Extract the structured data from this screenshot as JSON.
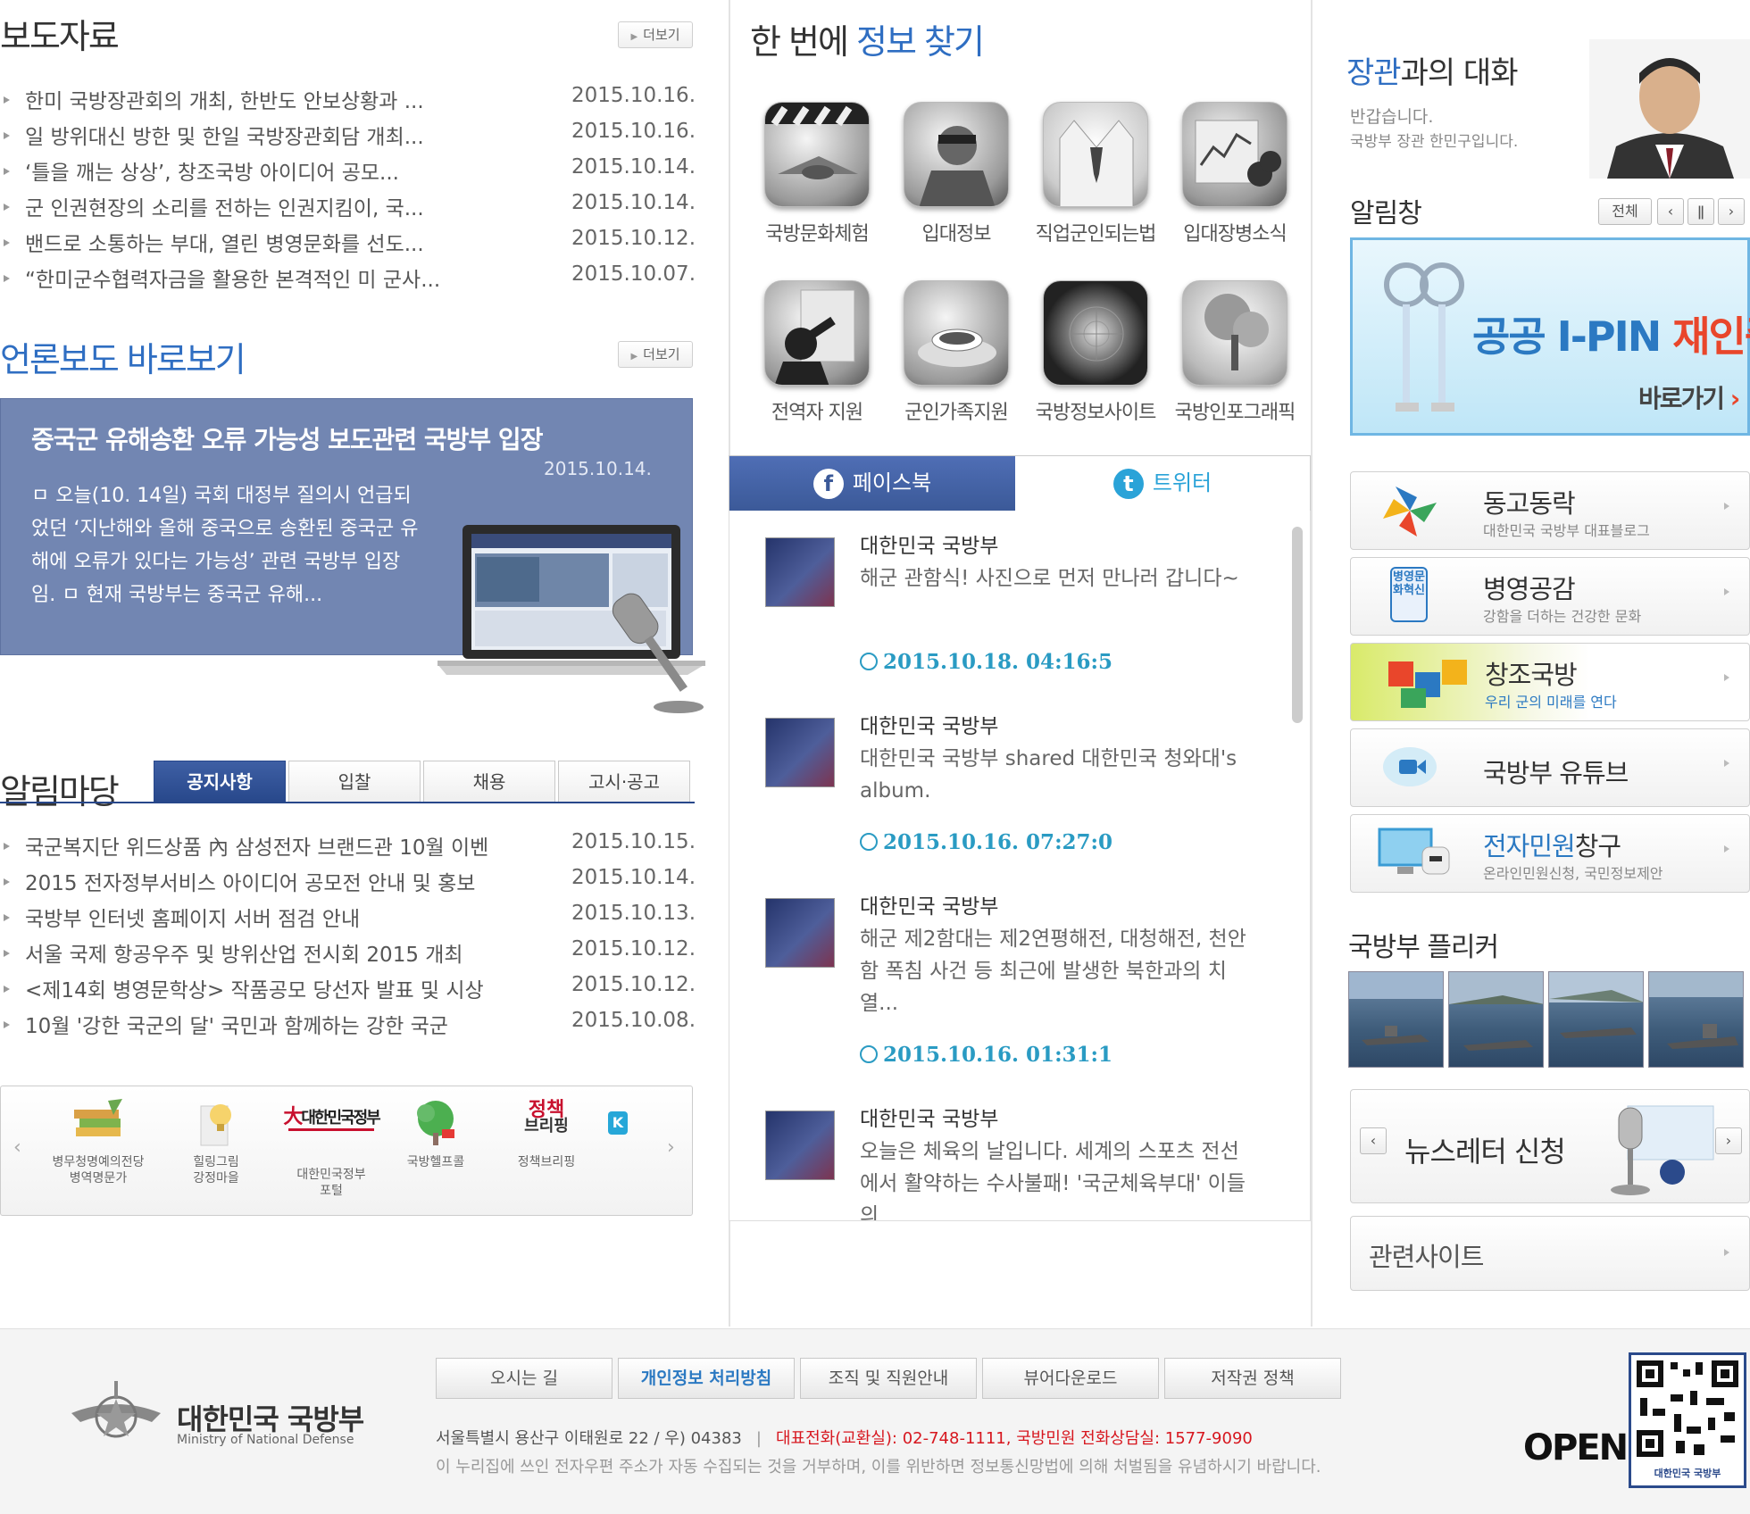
{
  "press": {
    "title": "보도자료",
    "more": "더보기",
    "items": [
      {
        "title": "한미 국방장관회의 개최, 한반도 안보상황과 ...",
        "date": "2015.10.16."
      },
      {
        "title": "일 방위대신 방한 및 한일 국방장관회담 개최...",
        "date": "2015.10.16."
      },
      {
        "title": "‘틀을 깨는 상상’, 창조국방 아이디어 공모...",
        "date": "2015.10.14."
      },
      {
        "title": "군 인권현장의 소리를 전하는 인권지킴이, 국...",
        "date": "2015.10.14."
      },
      {
        "title": "밴드로 소통하는 부대, 열린 병영문화를 선도...",
        "date": "2015.10.12."
      },
      {
        "title": "“한미군수협력자금을 활용한 본격적인 미 군사...",
        "date": "2015.10.07."
      }
    ]
  },
  "media": {
    "title": "언론보도 바로보기",
    "more": "더보기",
    "headline": "중국군 유해송환 오류 가능성 보도관련 국방부 입장",
    "date": "2015.10.14.",
    "body": "ㅁ 오늘(10. 14일) 국회 대정부 질의시 언급되었던 ‘지난해와 올해 중국으로 송환된 중국군 유해에 오류가 있다는 가능성’ 관련 국방부 입장임. ㅁ 현재 국방부는 중국군 유해..."
  },
  "notice": {
    "title": "알림마당",
    "tabs": [
      "공지사항",
      "입찰",
      "채용",
      "고시·공고"
    ],
    "items": [
      {
        "title": "국군복지단 위드상품 內 삼성전자 브랜드관 10월 이벤",
        "date": "2015.10.15."
      },
      {
        "title": "2015 전자정부서비스 아이디어 공모전 안내 및 홍보",
        "date": "2015.10.14."
      },
      {
        "title": "국방부 인터넷 홈페이지 서버 점검 안내",
        "date": "2015.10.13."
      },
      {
        "title": "서울 국제 항공우주 및 방위산업 전시회 2015 개최",
        "date": "2015.10.12."
      },
      {
        "title": "<제14회 병영문학상> 작품공모 당선자 발표 및 시상",
        "date": "2015.10.12."
      },
      {
        "title": "10월 '강한 국군의 달' 국민과 함께하는 강한 국군",
        "date": "2015.10.08."
      }
    ]
  },
  "banners": [
    {
      "l1": "병무청명예의전당",
      "l2": "병역명문가"
    },
    {
      "l1": "힐링그림",
      "l2": "강정마을"
    },
    {
      "l1": "대한민국정부",
      "l2": "포털"
    },
    {
      "l1": "국방헬프콜",
      "l2": ""
    },
    {
      "l1": "정책브리핑",
      "l2": ""
    }
  ],
  "banner_logo_texts": {
    "gov": "대한민국정부",
    "policy1": "정책",
    "policy2": "브리핑"
  },
  "find": {
    "title_prefix": "한 번에 ",
    "title_accent": "정보 찾기",
    "items": [
      "국방문화체험",
      "입대정보",
      "직업군인되는법",
      "입대장병소식",
      "전역자 지원",
      "군인가족지원",
      "국방정보사이트",
      "국방인포그래픽"
    ]
  },
  "sns": {
    "facebook": "페이스북",
    "twitter": "트위터",
    "posts": [
      {
        "name": "대한민국 국방부",
        "text": "해군 관함식! 사진으로 먼저 만나러 갑니다~",
        "time": "2015.10.18. 04:16:5"
      },
      {
        "name": "대한민국 국방부",
        "text": "대한민국 국방부 shared 대한민국 청와대's album.",
        "time": "2015.10.16. 07:27:0"
      },
      {
        "name": "대한민국 국방부",
        "text": "해군 제2함대는 제2연평해전, 대청해전, 천안함 폭침 사건 등 최근에 발생한 북한과의 치열...",
        "time": "2015.10.16. 01:31:1"
      },
      {
        "name": "대한민국 국방부",
        "text": "오늘은 체육의 날입니다. 세계의 스포츠 전선에서 활약하는 수사불패! '국군체육부대' 이들의",
        "time": ""
      }
    ]
  },
  "minister": {
    "accent": "장관",
    "title_rest": "과의 대화",
    "line1": "반갑습니다.",
    "line2": "국방부 장관 한민구입니다."
  },
  "alert": {
    "title": "알림창",
    "all": "전체",
    "ipin_title_a": "공공 I-PIN",
    "ipin_title_b": "재인증",
    "ipin_go": "바로가기"
  },
  "links": [
    {
      "title": "동고동락",
      "sub": "대한민국 국방부 대표블로그"
    },
    {
      "title": "병영공감",
      "sub": "강함을 더하는 건강한 문화"
    },
    {
      "title": "창조국방",
      "sub": "우리 군의 미래를 연다"
    },
    {
      "title": "국방부 유튜브",
      "sub": ""
    },
    {
      "title_accent": "전자민원",
      "title": "창구",
      "sub": "온라인민원신청, 국민정보제안"
    }
  ],
  "link_icon_text": "병영문화혁신",
  "flickr": {
    "title": "국방부 플리커"
  },
  "newsletter": {
    "label": "뉴스레터 신청"
  },
  "related": {
    "label": "관련사이트"
  },
  "footer": {
    "org_kr": "대한민국 국방부",
    "org_en": "Ministry of National Defense",
    "buttons": [
      "오시는 길",
      "개인정보 처리방침",
      "조직 및 직원안내",
      "뷰어다운로드",
      "저작권 정책"
    ],
    "address": "서울특별시 용산구 이태원로 22 / 우) 04383",
    "sep": "|",
    "phone": "대표전화(교환실): 02-748-1111, 국방민원 전화상담실: 1577-9090",
    "notice": "이 누리집에 쓰인 전자우편 주소가 자동 수집되는 것을 거부하며, 이를 위반하면 정보통신망법에 의해 처벌됨을 유념하시기 바랍니다.",
    "open": "OPEN",
    "qr_label": "대한민국 국방부"
  },
  "colors": {
    "accent": "#2f6ec2",
    "press_bg": "#7286b2",
    "tab_active": "#27478a",
    "facebook": "#3b5998",
    "twitter": "#2aa3d8",
    "timestamp": "#2a9bc3",
    "footer_red": "#d7171f"
  }
}
